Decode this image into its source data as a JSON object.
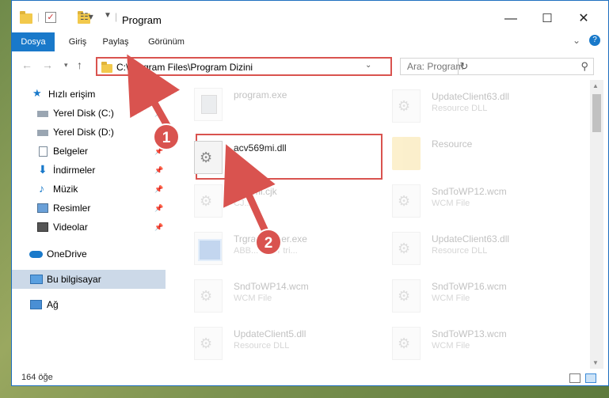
{
  "window": {
    "title": "Program",
    "controls": {
      "minimize": "—",
      "maximize": "☐",
      "close": "✕"
    }
  },
  "ribbon": {
    "tabs": [
      "Dosya",
      "Giriş",
      "Paylaş",
      "Görünüm"
    ],
    "expand_icon": "chevron-down",
    "help_icon": "help-circle"
  },
  "address": {
    "path": "C:\\Program Files\\Program Dizini",
    "search_placeholder": "Ara: Program"
  },
  "sidebar": {
    "items": [
      {
        "label": "Hızlı erişim",
        "icon": "star-icon",
        "pinned": false
      },
      {
        "label": "Yerel Disk (C:)",
        "icon": "drive-icon",
        "pinned": true
      },
      {
        "label": "Yerel Disk (D:)",
        "icon": "drive-icon",
        "pinned": true
      },
      {
        "label": "Belgeler",
        "icon": "documents-icon",
        "pinned": true
      },
      {
        "label": "İndirmeler",
        "icon": "download-icon",
        "pinned": true
      },
      {
        "label": "Müzik",
        "icon": "music-icon",
        "pinned": true
      },
      {
        "label": "Resimler",
        "icon": "pictures-icon",
        "pinned": true
      },
      {
        "label": "Videolar",
        "icon": "video-icon",
        "pinned": true
      },
      {
        "label": "OneDrive",
        "icon": "cloud-icon",
        "pinned": false
      },
      {
        "label": "Bu bilgisayar",
        "icon": "computer-icon",
        "pinned": false,
        "selected": true
      },
      {
        "label": "Ağ",
        "icon": "network-icon",
        "pinned": false
      }
    ]
  },
  "files": {
    "left": [
      {
        "name": "program.exe",
        "sub": "",
        "type": "exe"
      },
      {
        "name": "acv569mi.dll",
        "sub": "",
        "type": "dll"
      },
      {
        "name": "Fa...ml.cjk",
        "sub": "CJ...",
        "type": "dll"
      },
      {
        "name": "Trgra...stalter.exe",
        "sub": "ABB... ...der tri...",
        "type": "inst"
      },
      {
        "name": "SndToWP14.wcm",
        "sub": "WCM File",
        "type": "dll"
      },
      {
        "name": "UpdateClient5.dll",
        "sub": "Resource DLL",
        "type": "dll"
      }
    ],
    "right": [
      {
        "name": "UpdateClient63.dll",
        "sub": "Resource DLL",
        "type": "dll"
      },
      {
        "name": "Resource",
        "sub": "",
        "type": "folder"
      },
      {
        "name": "SndToWP12.wcm",
        "sub": "WCM File",
        "type": "dll"
      },
      {
        "name": "UpdateClient63.dll",
        "sub": "Resource DLL",
        "type": "dll"
      },
      {
        "name": "SndToWP16.wcm",
        "sub": "WCM File",
        "type": "dll"
      },
      {
        "name": "SndToWP13.wcm",
        "sub": "WCM File",
        "type": "dll"
      }
    ]
  },
  "status": {
    "item_count": "164 öğe"
  },
  "annotations": {
    "step1": "1",
    "step2": "2",
    "color": "#d9534f"
  }
}
